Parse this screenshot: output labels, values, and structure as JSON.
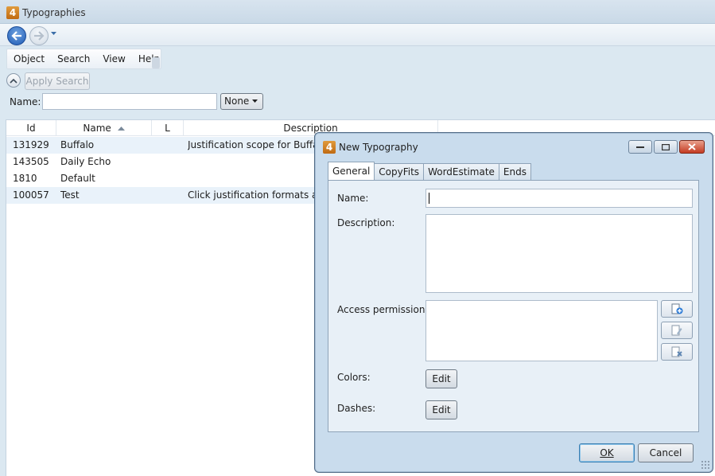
{
  "window": {
    "logo_text": "4",
    "title": "Typographies"
  },
  "menu": {
    "items": [
      "Object",
      "Search",
      "View",
      "Help"
    ]
  },
  "search": {
    "apply_label": "Apply Search",
    "name_label": "Name:",
    "name_value": "",
    "filter_value": "None"
  },
  "grid": {
    "columns": [
      "Id",
      "Name",
      "L",
      "Description"
    ],
    "sort_column": "Name",
    "rows": [
      {
        "id": "131929",
        "name": "Buffalo",
        "l": "",
        "description": "Justification scope for Buffalo"
      },
      {
        "id": "143505",
        "name": "Daily Echo",
        "l": "",
        "description": ""
      },
      {
        "id": "1810",
        "name": "Default",
        "l": "",
        "description": ""
      },
      {
        "id": "100057",
        "name": "Test",
        "l": "",
        "description": "Click justification formats and"
      }
    ]
  },
  "dialog": {
    "logo_text": "4",
    "title": "New Typography",
    "tabs": [
      "General",
      "CopyFits",
      "WordEstimate",
      "Ends"
    ],
    "active_tab": "General",
    "labels": {
      "name": "Name:",
      "description": "Description:",
      "access": "Access permissions:",
      "colors": "Colors:",
      "dashes": "Dashes:"
    },
    "values": {
      "name": "",
      "description": ""
    },
    "edit_label": "Edit",
    "ok_label": "OK",
    "cancel_label": "Cancel",
    "side_icons": [
      "add-permission-icon",
      "edit-permission-icon",
      "remove-permission-icon"
    ]
  },
  "colors": {
    "selected_row": "#e9f2fa",
    "accent": "#1f5bb5",
    "close": "#c43b22"
  }
}
